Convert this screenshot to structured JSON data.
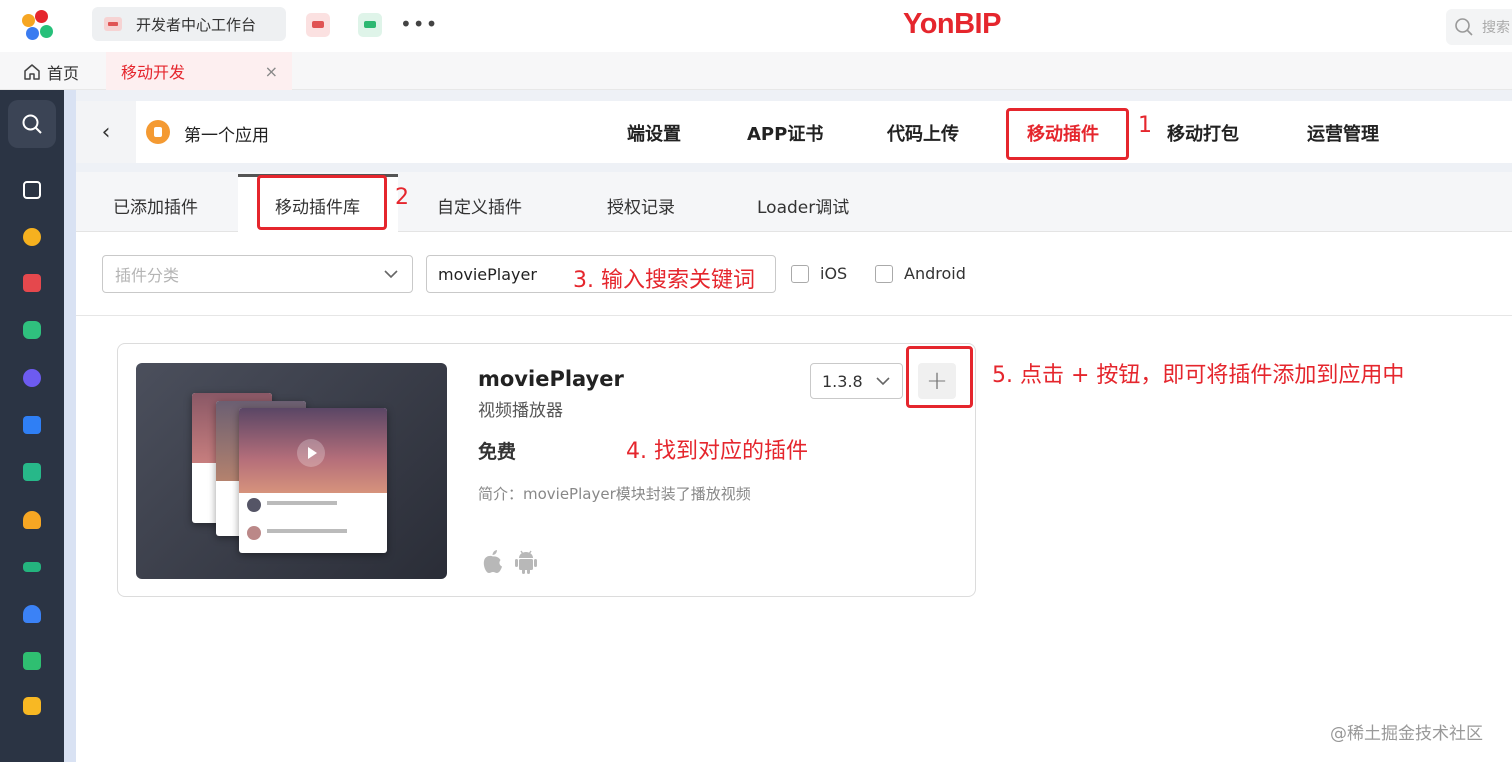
{
  "topbar": {
    "workbench_tab": "开发者中心工作台",
    "more": "•••",
    "brand": "YonBIP",
    "search_placeholder": "搜索"
  },
  "tabbar": {
    "home": "首页",
    "open_tab": "移动开发",
    "close": "×"
  },
  "app_header": {
    "back": "‹",
    "app_name": "第一个应用",
    "nav": [
      "端设置",
      "APP证书",
      "代码上传",
      "移动插件",
      "移动打包",
      "运营管理"
    ]
  },
  "subtabs": [
    "已添加插件",
    "移动插件库",
    "自定义插件",
    "授权记录",
    "Loader调试"
  ],
  "filters": {
    "category_placeholder": "插件分类",
    "search_value": "moviePlayer",
    "ios_label": "iOS",
    "android_label": "Android"
  },
  "plugin": {
    "name": "moviePlayer",
    "subtitle": "视频播放器",
    "price": "免费",
    "description": "简介：moviePlayer模块封装了播放视频",
    "version": "1.3.8",
    "add": "+"
  },
  "annotations": {
    "a1": "1",
    "a2": "2",
    "a3": "3. 输入搜索关键词",
    "a4": "4. 找到对应的插件",
    "a5": "5. 点击 + 按钮，即可将插件添加到应用中"
  },
  "watermark": "@稀土掘金技术社区",
  "colors": {
    "accent": "#e5262d",
    "sidebar": "#2b3444"
  }
}
